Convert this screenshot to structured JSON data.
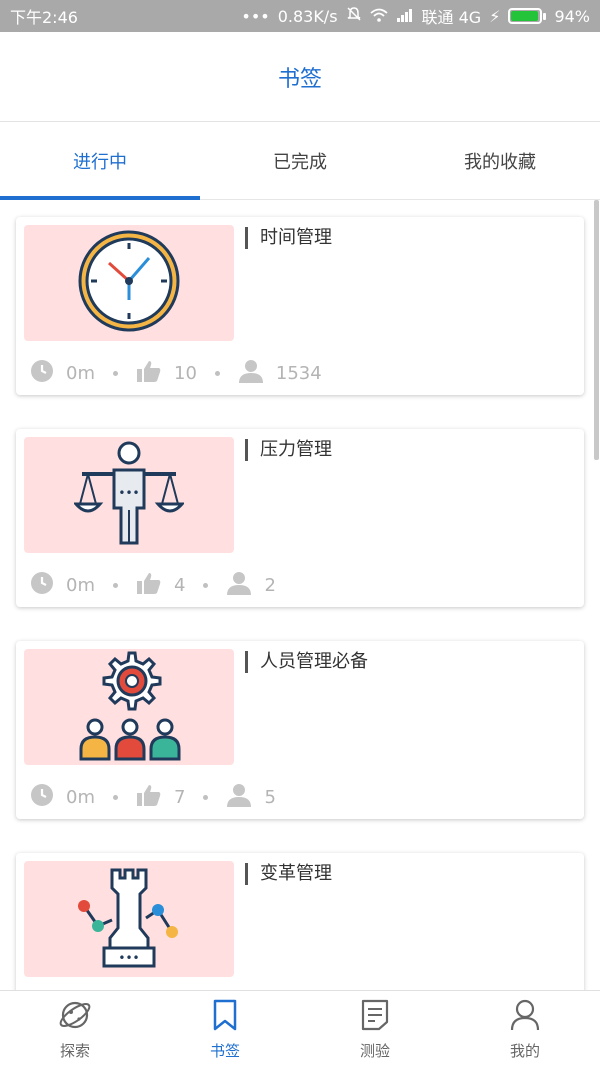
{
  "status_bar": {
    "time": "下午2:46",
    "network_speed": "0.83K/s",
    "carrier": "联通 4G",
    "battery": "94%",
    "battery_level": 0.94,
    "battery_color": "#23c43a"
  },
  "header": {
    "title": "书签"
  },
  "tabs": [
    {
      "label": "进行中",
      "active": true
    },
    {
      "label": "已完成",
      "active": false
    },
    {
      "label": "我的收藏",
      "active": false
    }
  ],
  "cards": [
    {
      "title": "时间管理",
      "duration": "0m",
      "likes": "10",
      "users": "1534",
      "icon": "clock-icon"
    },
    {
      "title": "压力管理",
      "duration": "0m",
      "likes": "4",
      "users": "2",
      "icon": "scale-person-icon"
    },
    {
      "title": "人员管理必备",
      "duration": "0m",
      "likes": "7",
      "users": "5",
      "icon": "team-gear-icon"
    },
    {
      "title": "变革管理",
      "duration": "",
      "likes": "",
      "users": "",
      "icon": "chess-rook-icon"
    }
  ],
  "bottom_nav": [
    {
      "label": "探索",
      "icon": "planet-icon",
      "active": false
    },
    {
      "label": "书签",
      "icon": "bookmark-icon",
      "active": true
    },
    {
      "label": "测验",
      "icon": "note-icon",
      "active": false
    },
    {
      "label": "我的",
      "icon": "user-icon",
      "active": false
    }
  ],
  "colors": {
    "accent": "#1f6fd1",
    "thumb_bg": "#ffdfdf"
  }
}
